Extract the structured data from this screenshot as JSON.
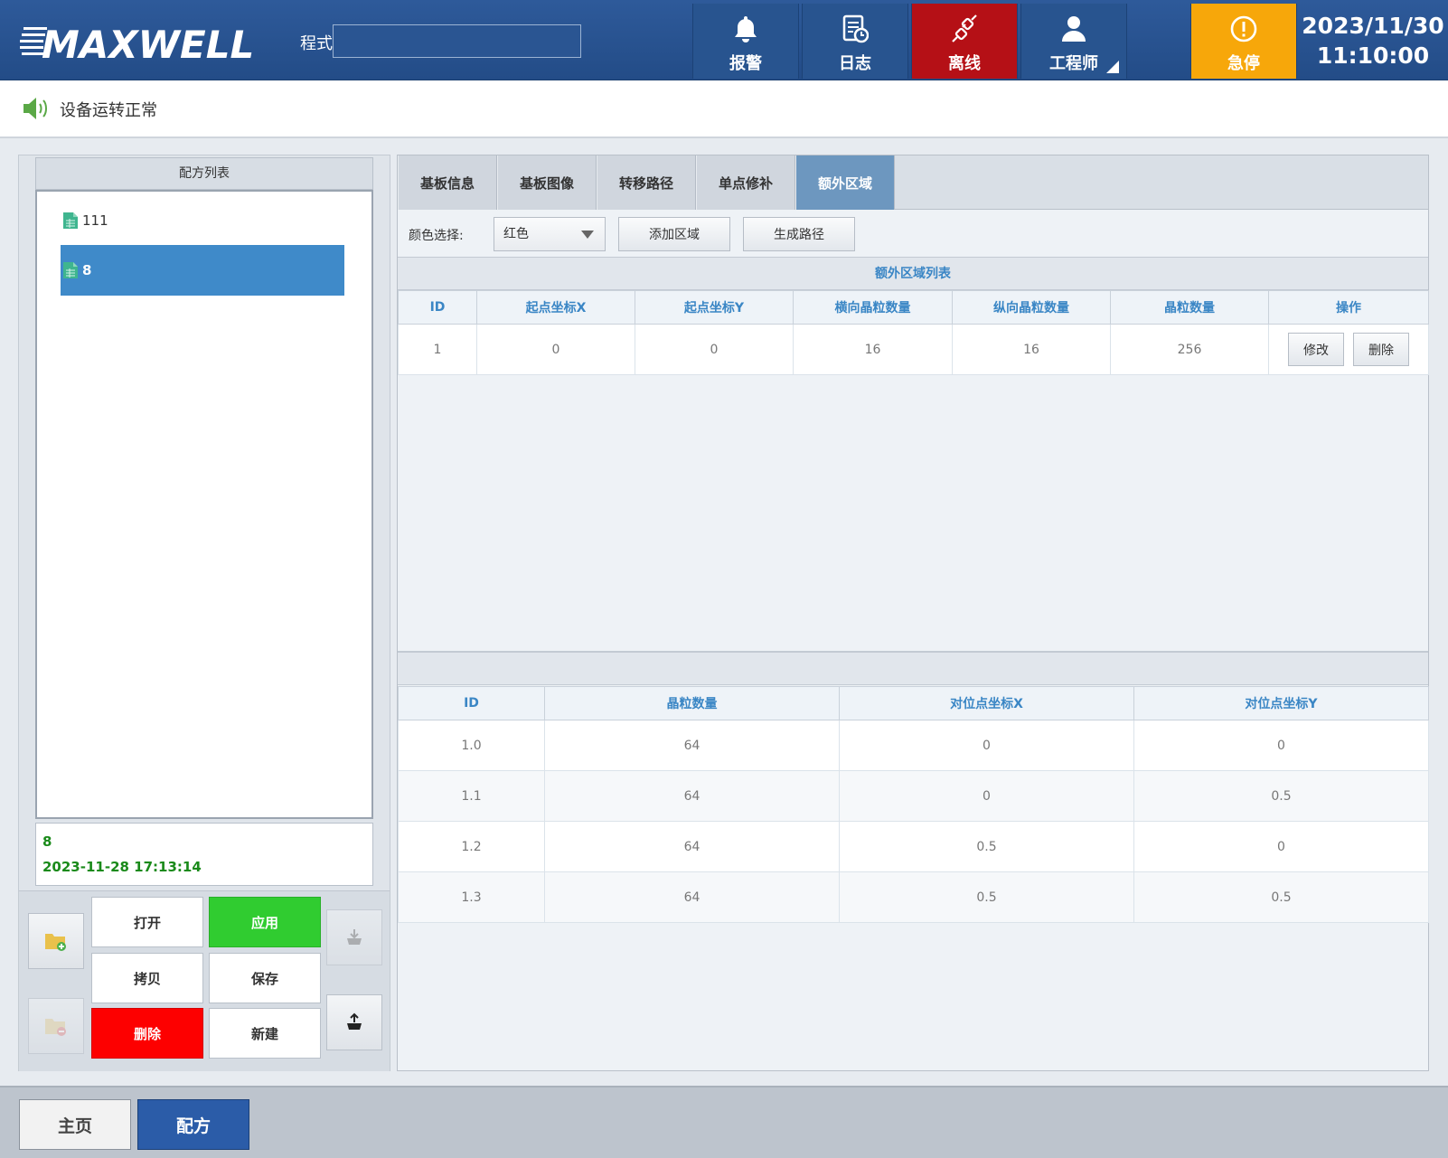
{
  "header": {
    "logo_text": "MAXWELL",
    "program_label": "程式",
    "program_value": "",
    "buttons": {
      "alarm": "报警",
      "log": "日志",
      "offline": "离线",
      "engineer": "工程师",
      "estop": "急停"
    },
    "date": "2023/11/30",
    "time": "11:10:00"
  },
  "status": {
    "text": "设备运转正常"
  },
  "recipe_panel": {
    "title": "配方列表",
    "items": [
      {
        "name": "111",
        "selected": false
      },
      {
        "name": "8",
        "selected": true
      }
    ],
    "info": {
      "name": "8",
      "timestamp": "2023-11-28 17:13:14"
    },
    "actions": {
      "open": "打开",
      "apply": "应用",
      "copy": "拷贝",
      "save": "保存",
      "delete": "删除",
      "new": "新建"
    }
  },
  "tabs": [
    {
      "label": "基板信息",
      "active": false
    },
    {
      "label": "基板图像",
      "active": false
    },
    {
      "label": "转移路径",
      "active": false
    },
    {
      "label": "单点修补",
      "active": false
    },
    {
      "label": "额外区域",
      "active": true
    }
  ],
  "toolbar": {
    "color_label": "颜色选择:",
    "color_value": "红色",
    "add_area": "添加区域",
    "generate_path": "生成路径"
  },
  "area_table": {
    "title": "额外区域列表",
    "columns": [
      "ID",
      "起点坐标X",
      "起点坐标Y",
      "横向晶粒数量",
      "纵向晶粒数量",
      "晶粒数量",
      "操作"
    ],
    "rows": [
      {
        "id": "1",
        "x": "0",
        "y": "0",
        "h": "16",
        "v": "16",
        "count": "256",
        "edit": "修改",
        "remove": "删除"
      }
    ]
  },
  "detail_table": {
    "columns": [
      "ID",
      "晶粒数量",
      "对位点坐标X",
      "对位点坐标Y"
    ],
    "rows": [
      [
        "1.0",
        "64",
        "0",
        "0"
      ],
      [
        "1.1",
        "64",
        "0",
        "0.5"
      ],
      [
        "1.2",
        "64",
        "0.5",
        "0"
      ],
      [
        "1.3",
        "64",
        "0.5",
        "0.5"
      ]
    ]
  },
  "bottom_nav": {
    "home": "主页",
    "recipe": "配方"
  },
  "colors": {
    "header_bg": "#2e5a9a",
    "offline_red": "#b51016",
    "estop_orange": "#f7a70a",
    "selected_blue": "#3f8ac9",
    "apply_green": "#30cc30",
    "delete_red": "#fd0000",
    "table_header_text": "#3a86c5",
    "active_tab": "#6d97bf",
    "info_text_green": "#1a8a1a"
  }
}
